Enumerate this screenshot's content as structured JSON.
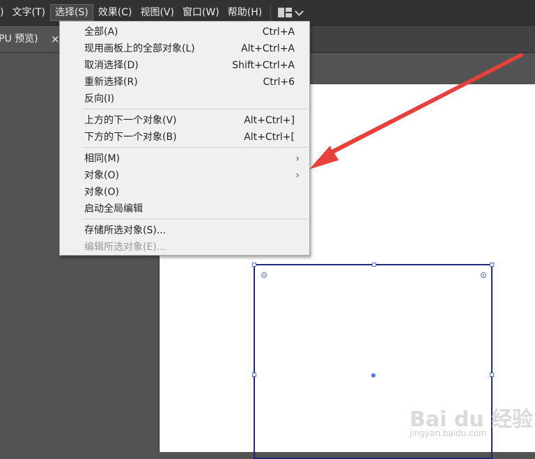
{
  "menubar": {
    "items": [
      {
        "label": ")",
        "active": false
      },
      {
        "label": "文字(T)",
        "active": false
      },
      {
        "label": "选择(S)",
        "active": true
      },
      {
        "label": "效果(C)",
        "active": false
      },
      {
        "label": "视图(V)",
        "active": false
      },
      {
        "label": "窗口(W)",
        "active": false
      },
      {
        "label": "帮助(H)",
        "active": false
      }
    ],
    "workspace_icon": "workspace-layout-icon"
  },
  "tab": {
    "label": "PU 预览)",
    "close": "×"
  },
  "select_menu": {
    "items": [
      {
        "label": "全部(A)",
        "shortcut": "Ctrl+A"
      },
      {
        "label": "现用画板上的全部对象(L)",
        "shortcut": "Alt+Ctrl+A"
      },
      {
        "label": "取消选择(D)",
        "shortcut": "Shift+Ctrl+A"
      },
      {
        "label": "重新选择(R)",
        "shortcut": "Ctrl+6"
      },
      {
        "label": "反向(I)",
        "shortcut": ""
      },
      {
        "label": "上方的下一个对象(V)",
        "shortcut": "Alt+Ctrl+]"
      },
      {
        "label": "下方的下一个对象(B)",
        "shortcut": "Alt+Ctrl+["
      },
      {
        "label": "相同(M)",
        "shortcut": "",
        "submenu": true
      },
      {
        "label": "对象(O)",
        "shortcut": "",
        "submenu": true
      },
      {
        "label": "对象(O)",
        "shortcut": ""
      },
      {
        "label": "启动全局编辑",
        "shortcut": ""
      },
      {
        "label": "存储所选对象(S)...",
        "shortcut": ""
      },
      {
        "label": "编辑所选对象(E)...",
        "shortcut": "",
        "disabled": true
      }
    ],
    "submenu_glyph": "›"
  },
  "annotation": {
    "color": "#e8403a"
  },
  "watermark": {
    "main": "Bai du 经验",
    "sub": "jingyan.baidu.com"
  },
  "colors": {
    "menubar_bg": "#323232",
    "menu_bg": "#f0f0f0",
    "selection_stroke": "#1c2a7a",
    "handle_color": "#4a6fe0"
  }
}
